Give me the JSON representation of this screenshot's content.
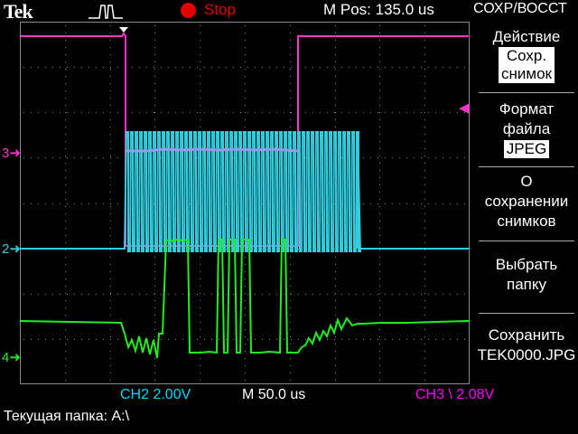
{
  "header": {
    "brand": "Tek",
    "run_state": "Stop",
    "horizontal_position": "M Pos: 135.0 us",
    "menu_title": "СОХР/ВОССТ"
  },
  "side_menu": {
    "action_label": "Действие",
    "action_value_line1": "Сохр.",
    "action_value_line2": "снимок",
    "format_line1": "Формат",
    "format_line2": "файла",
    "format_value": "JPEG",
    "about_line1": "О",
    "about_line2": "сохранении",
    "about_line3": "снимков",
    "folder_line1": "Выбрать",
    "folder_line2": "папку",
    "save_line1": "Сохранить",
    "save_line2": "TEK0000.JPG"
  },
  "channel_markers": {
    "ch3": "3",
    "ch2": "2",
    "ch4": "4"
  },
  "status": {
    "ch2_scale": "CH2  2.00V",
    "time_scale": "M 50.0 us",
    "ch3_trigger": "CH3 \\ 2.08V",
    "current_folder": "Текущая папка: A:\\"
  },
  "colors": {
    "ch3": "#ff33cc",
    "ch2": "#33ccdd",
    "ch4": "#22ee22",
    "ch_overlay": "#9999ee",
    "stop": "#e60000",
    "grid": "#888888"
  }
}
